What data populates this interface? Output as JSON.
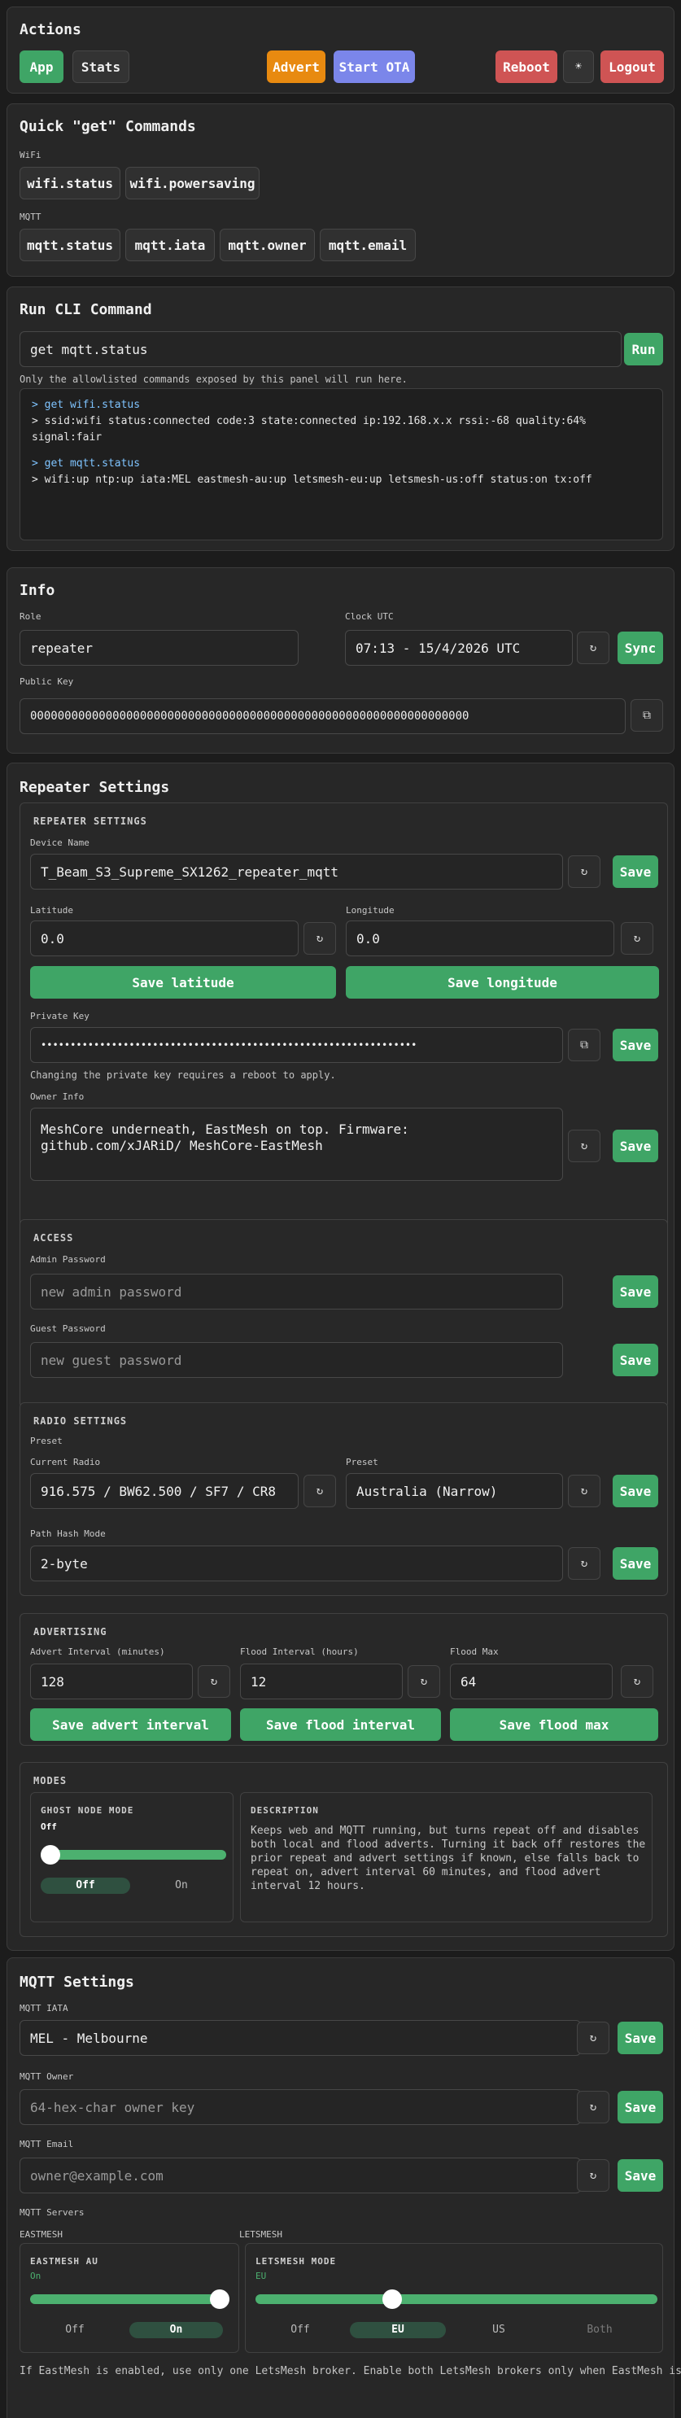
{
  "actions": {
    "title": "Actions",
    "app": "App",
    "stats": "Stats",
    "advert": "Advert",
    "start_ota": "Start OTA",
    "reboot": "Reboot",
    "theme": "☀",
    "logout": "Logout"
  },
  "quick": {
    "title": "Quick \"get\" Commands",
    "wifi_label": "WiFi",
    "wifi": [
      "wifi.status",
      "wifi.powersaving"
    ],
    "mqtt_label": "MQTT",
    "mqtt": [
      "mqtt.status",
      "mqtt.iata",
      "mqtt.owner",
      "mqtt.email"
    ]
  },
  "cli": {
    "title": "Run CLI Command",
    "input": "get mqtt.status",
    "run": "Run",
    "note": "Only the allowlisted commands exposed by this panel will run here.",
    "out": [
      {
        "cmd": "> get wifi.status",
        "resp": "> ssid:wifi status:connected code:3 state:connected ip:192.168.x.x rssi:-68 quality:64% signal:fair"
      },
      {
        "cmd": "> get mqtt.status",
        "resp": "> wifi:up ntp:up iata:MEL eastmesh-au:up letsmesh-eu:up letsmesh-us:off status:on tx:off"
      }
    ]
  },
  "info": {
    "title": "Info",
    "role_label": "Role",
    "role": "repeater",
    "clock_label": "Clock UTC",
    "clock": "07:13 - 15/4/2026 UTC",
    "sync": "Sync",
    "pubkey_label": "Public Key",
    "pubkey": "0000000000000000000000000000000000000000000000000000000000000000"
  },
  "repeater": {
    "title": "Repeater Settings",
    "save": "Save",
    "settings": {
      "heading": "REPEATER SETTINGS",
      "device_label": "Device Name",
      "device": "T_Beam_S3_Supreme_SX1262_repeater_mqtt",
      "lat_label": "Latitude",
      "lat": "0.0",
      "lon_label": "Longitude",
      "lon": "0.0",
      "save_lat": "Save latitude",
      "save_lon": "Save longitude",
      "pk_label": "Private Key",
      "pk": "••••••••••••••••••••••••••••••••••••••••••••••••••••••••••••••••",
      "pk_note": "Changing the private key requires a reboot to apply.",
      "owner_label": "Owner Info",
      "owner": "MeshCore underneath, EastMesh on top. Firmware: github.com/xJARiD/ MeshCore-EastMesh"
    },
    "access": {
      "heading": "ACCESS",
      "admin_label": "Admin Password",
      "admin_ph": "new admin password",
      "guest_label": "Guest Password",
      "guest_ph": "new guest password"
    },
    "radio": {
      "heading": "RADIO SETTINGS",
      "preset_label": "Preset",
      "current_label": "Current Radio",
      "current": "916.575 / BW62.500 / SF7 / CR8",
      "preset2_label": "Preset",
      "preset": "Australia (Narrow)",
      "hash_label": "Path Hash Mode",
      "hash": "2-byte"
    },
    "advert": {
      "heading": "ADVERTISING",
      "interval_label": "Advert Interval (minutes)",
      "interval": "128",
      "flood_label": "Flood Interval (hours)",
      "flood": "12",
      "max_label": "Flood Max",
      "max": "64",
      "save_interval": "Save advert interval",
      "save_flood": "Save flood interval",
      "save_max": "Save flood max"
    },
    "modes": {
      "heading": "MODES",
      "ghost_heading": "GHOST NODE MODE",
      "ghost_state": "Off",
      "ghost_off": "Off",
      "ghost_on": "On",
      "ghost_level": 0,
      "desc_heading": "DESCRIPTION",
      "desc": "Keeps web and MQTT running, but turns repeat off and disables both local and flood adverts. Turning it back off restores the prior repeat and advert settings if known, else falls back to repeat on, advert interval 60 minutes, and flood advert interval 12 hours."
    }
  },
  "mqtt": {
    "title": "MQTT Settings",
    "save": "Save",
    "iata_label": "MQTT IATA",
    "iata": "MEL - Melbourne",
    "owner_label": "MQTT Owner",
    "owner_ph": "64-hex-char owner key",
    "email_label": "MQTT Email",
    "email_ph": "owner@example.com",
    "servers_label": "MQTT Servers",
    "eastmesh_label": "EASTMESH",
    "eastmesh_heading": "EASTMESH AU",
    "eastmesh_state": "On",
    "eastmesh_off": "Off",
    "eastmesh_on": "On",
    "eastmesh_level": 1,
    "letsmesh_label": "LETSMESH",
    "letsmesh_heading": "LETSMESH MODE",
    "letsmesh_state": "EU",
    "letsmesh_opts": [
      "Off",
      "EU",
      "US",
      "Both"
    ],
    "letsmesh_level": 0.333,
    "note": "If EastMesh is enabled, use only one LetsMesh broker. Enable both LetsMesh brokers only when EastMesh is off.",
    "accent": "#3fa566"
  }
}
